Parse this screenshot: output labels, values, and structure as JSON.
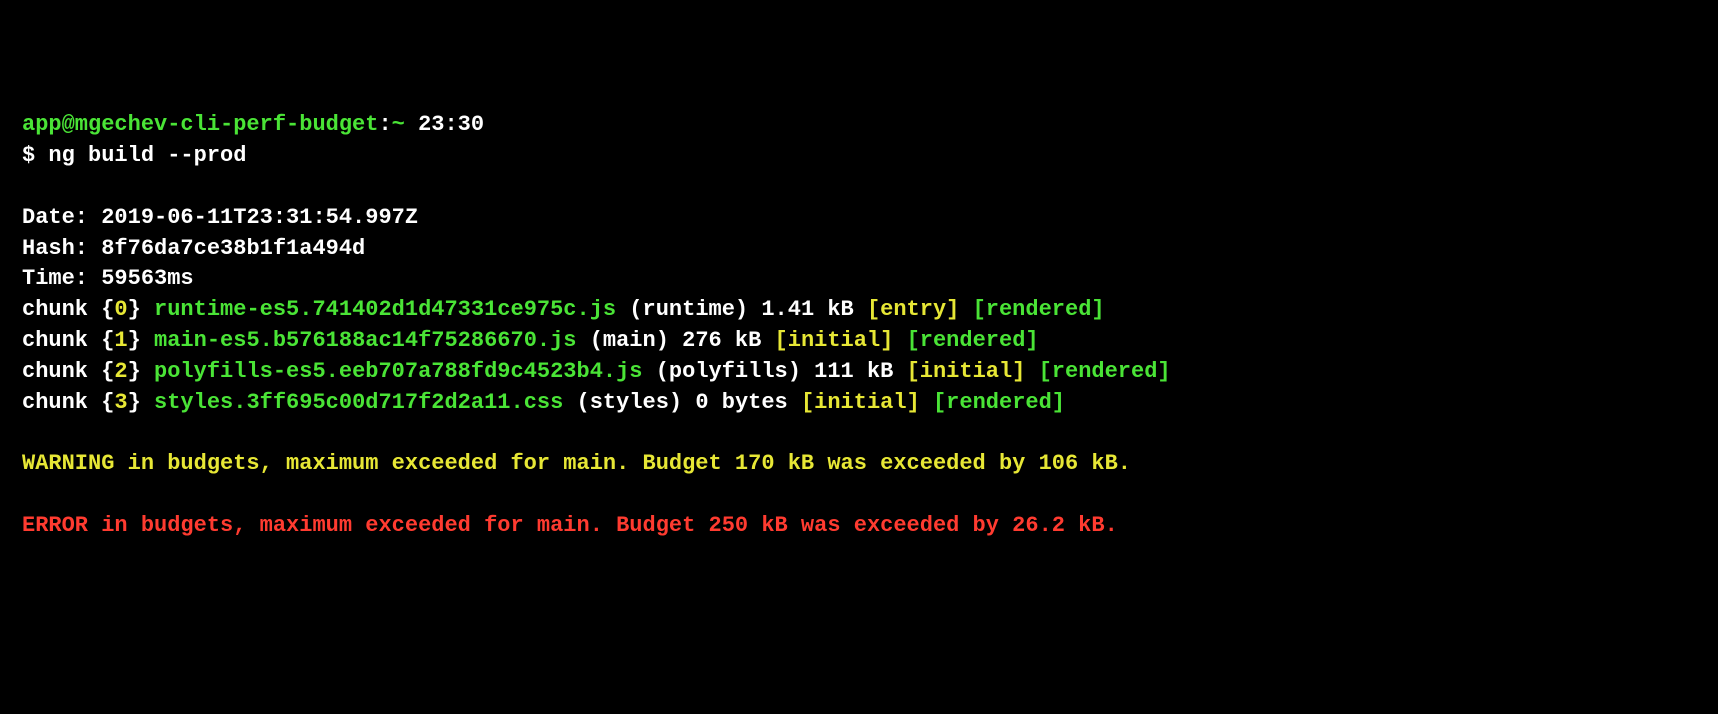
{
  "prompt": {
    "user_host": "app@mgechev-cli-perf-budget",
    "colon": ":",
    "tilde": "~",
    "time": "23:30",
    "symbol": "$ ",
    "command": "ng build --prod"
  },
  "build": {
    "date_label": "Date: ",
    "date_value": "2019-06-11T23:31:54.997Z",
    "hash_label": "Hash: ",
    "hash_value": "8f76da7ce38b1f1a494d",
    "time_label": "Time: ",
    "time_value": "59563ms"
  },
  "chunks": [
    {
      "prefix": "chunk {",
      "id": "0",
      "close_brace": "} ",
      "file": "runtime-es5.741402d1d47331ce975c.js",
      "name": " (runtime) 1.41 kB ",
      "tag1": "[entry]",
      "space": " ",
      "tag2": "[rendered]"
    },
    {
      "prefix": "chunk {",
      "id": "1",
      "close_brace": "} ",
      "file": "main-es5.b576188ac14f75286670.js",
      "name": " (main) 276 kB ",
      "tag1": "[initial]",
      "space": " ",
      "tag2": "[rendered]"
    },
    {
      "prefix": "chunk {",
      "id": "2",
      "close_brace": "} ",
      "file": "polyfills-es5.eeb707a788fd9c4523b4.js",
      "name": " (polyfills) 111 kB ",
      "tag1": "[initial]",
      "space": " ",
      "tag2": "[rendered]"
    },
    {
      "prefix": "chunk {",
      "id": "3",
      "close_brace": "} ",
      "file": "styles.3ff695c00d717f2d2a11.css",
      "name": " (styles) 0 bytes ",
      "tag1": "[initial]",
      "space": " ",
      "tag2": "[rendered]"
    }
  ],
  "warning": "WARNING in budgets, maximum exceeded for main. Budget 170 kB was exceeded by 106 kB.",
  "error": "ERROR in budgets, maximum exceeded for main. Budget 250 kB was exceeded by 26.2 kB.",
  "blank": " "
}
